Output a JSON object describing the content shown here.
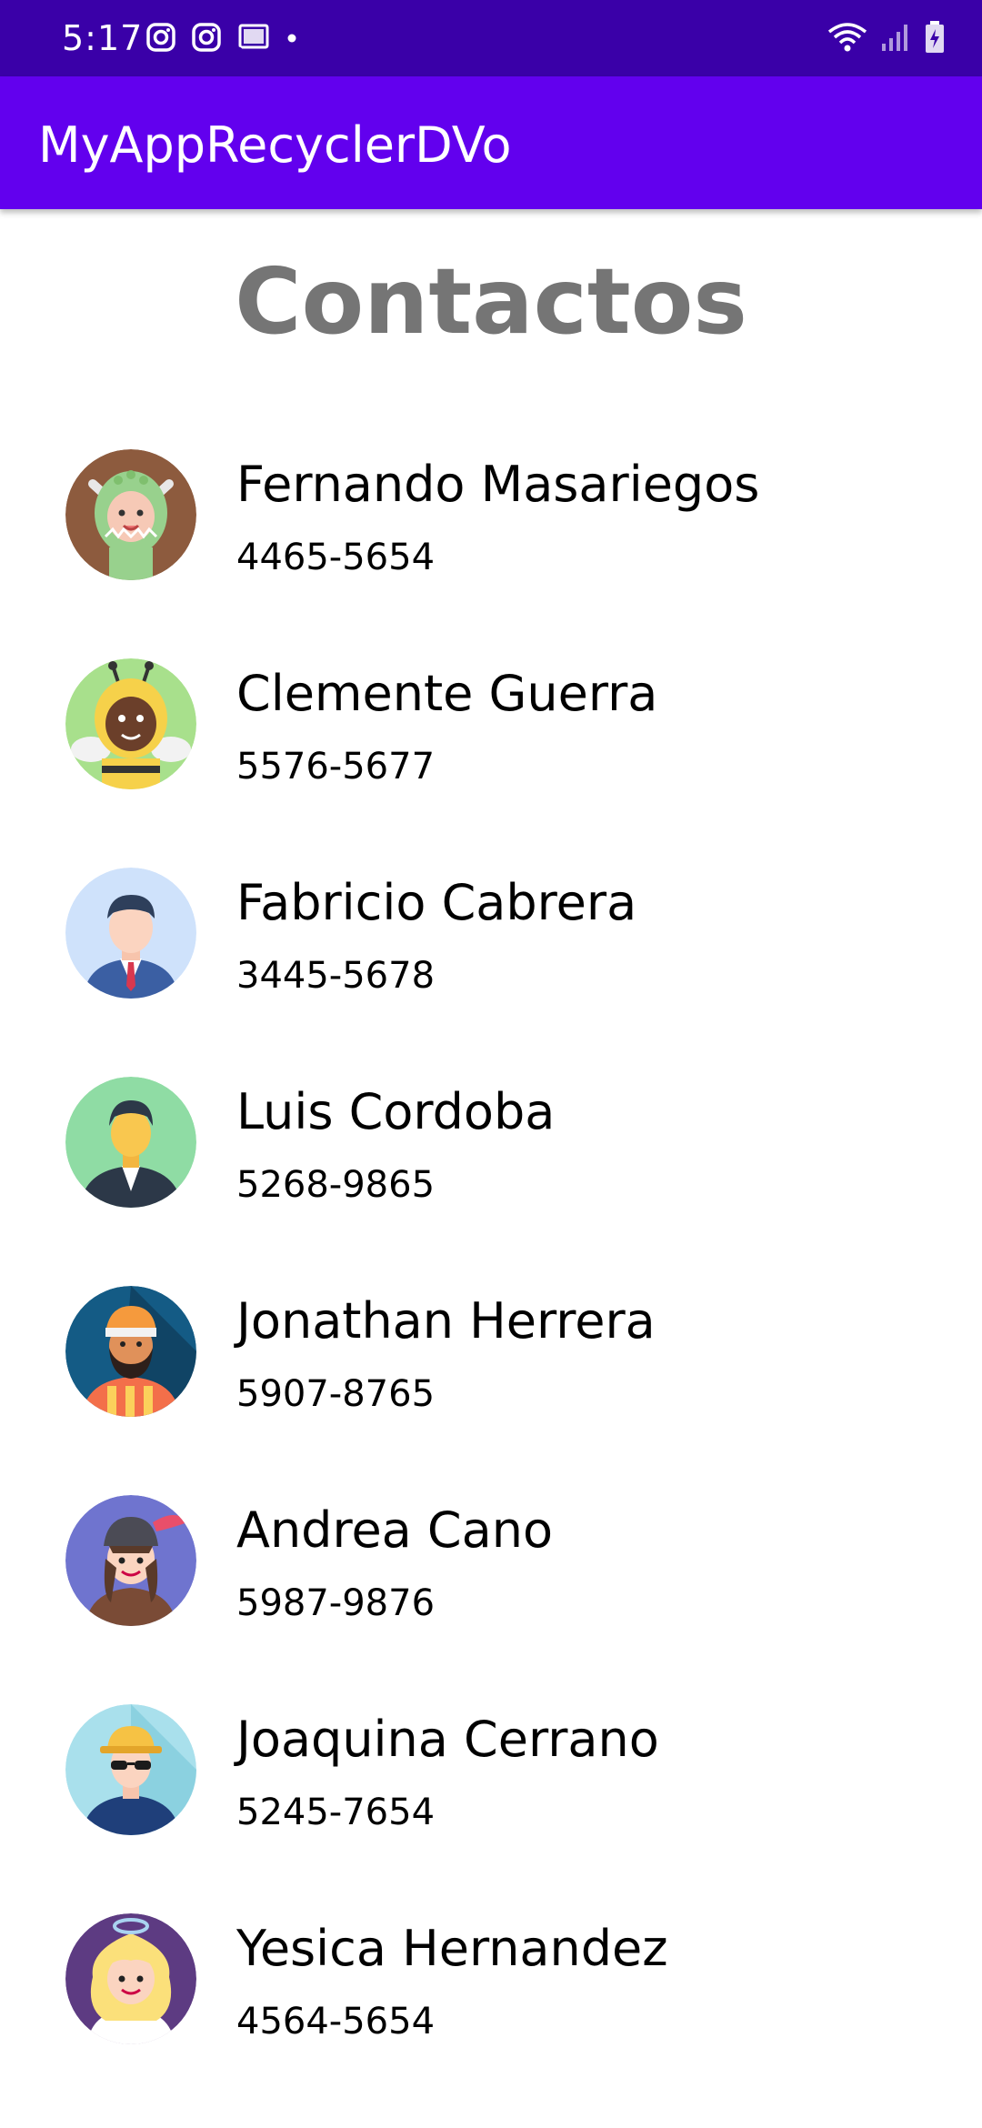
{
  "status_bar": {
    "time": "5:17",
    "left_icons": [
      "instagram-icon",
      "instagram-icon",
      "cast-icon",
      "dot-icon"
    ],
    "right_icons": [
      "wifi-icon",
      "signal-icon",
      "battery-icon"
    ]
  },
  "app_bar": {
    "title": "MyAppRecyclerDVo",
    "color": "#6200ee"
  },
  "page": {
    "title": "Contactos"
  },
  "contacts": [
    {
      "name": "Fernando Masariegos",
      "phone": "4465-5654",
      "avatar": "dragon-costume-avatar-icon",
      "bg": "#8d5b3e"
    },
    {
      "name": "Clemente Guerra",
      "phone": "5576-5677",
      "avatar": "bee-costume-avatar-icon",
      "bg": "#a8e08c"
    },
    {
      "name": "Fabricio Cabrera",
      "phone": "3445-5678",
      "avatar": "businessman-avatar-icon",
      "bg": "#cfe2fb"
    },
    {
      "name": "Luis Cordoba",
      "phone": "5268-9865",
      "avatar": "suit-man-avatar-icon",
      "bg": "#8fdca4"
    },
    {
      "name": "Jonathan Herrera",
      "phone": "5907-8765",
      "avatar": "turban-man-avatar-icon",
      "bg": "#145b85"
    },
    {
      "name": "Andrea Cano",
      "phone": "5987-9876",
      "avatar": "cap-girl-avatar-icon",
      "bg": "#6f74cf"
    },
    {
      "name": "Joaquina Cerrano",
      "phone": "5245-7654",
      "avatar": "hardhat-worker-avatar-icon",
      "bg": "#a9e0ec"
    },
    {
      "name": "Yesica Hernandez",
      "phone": "4564-5654",
      "avatar": "blonde-girl-avatar-icon",
      "bg": "#5d3b82"
    }
  ]
}
